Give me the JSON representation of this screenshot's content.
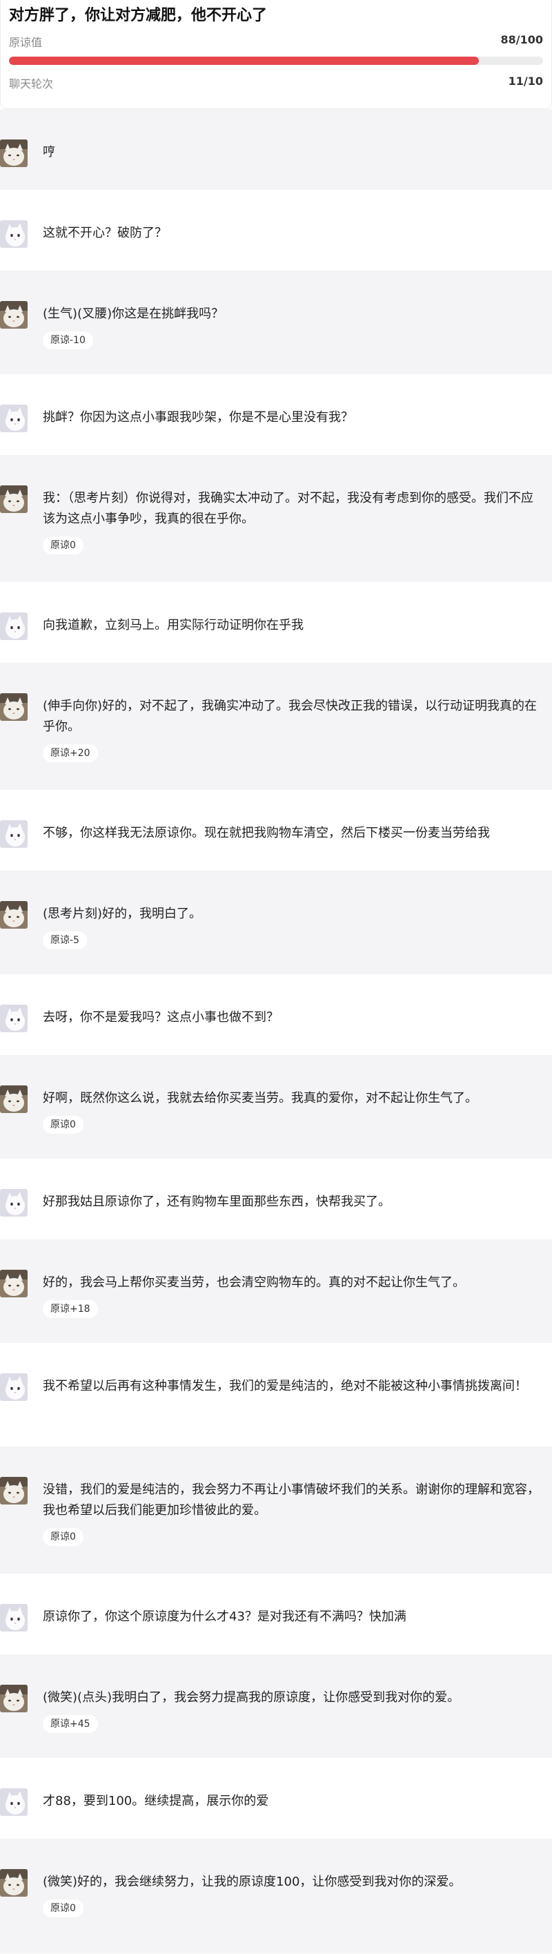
{
  "header": {
    "title": "对方胖了，你让对方减肥，他不开心了",
    "forgiveness": {
      "label": "原谅值",
      "value_text": "88/100",
      "level": 0.88
    },
    "rounds": {
      "label": "聊天轮次",
      "value_text": "11/10"
    },
    "colors": {
      "progress_fill": "#e7464d",
      "progress_track": "#ececec"
    }
  },
  "messages": [
    {
      "role": "bot",
      "avatar_icon": "cat-avatar-icon",
      "text": "哼"
    },
    {
      "role": "user",
      "avatar_icon": "user-avatar-icon",
      "text": "这就不开心？破防了？"
    },
    {
      "role": "bot",
      "avatar_icon": "cat-avatar-icon",
      "text": "(生气)(叉腰)你这是在挑衅我吗？",
      "badge": "原谅-10"
    },
    {
      "role": "user",
      "avatar_icon": "user-avatar-icon",
      "text": "挑衅？你因为这点小事跟我吵架，你是不是心里没有我？"
    },
    {
      "role": "bot",
      "avatar_icon": "cat-avatar-icon",
      "text": "我：（思考片刻）你说得对，我确实太冲动了。对不起，我没有考虑到你的感受。我们不应该为这点小事争吵，我真的很在乎你。",
      "badge": "原谅0"
    },
    {
      "role": "user",
      "avatar_icon": "user-avatar-icon",
      "text": "向我道歉，立刻马上。用实际行动证明你在乎我"
    },
    {
      "role": "bot",
      "avatar_icon": "cat-avatar-icon",
      "text": "(伸手向你)好的，对不起了，我确实冲动了。我会尽快改正我的错误，以行动证明我真的在乎你。",
      "badge": "原谅+20"
    },
    {
      "role": "user",
      "avatar_icon": "user-avatar-icon",
      "text": "不够，你这样我无法原谅你。现在就把我购物车清空，然后下楼买一份麦当劳给我"
    },
    {
      "role": "bot",
      "avatar_icon": "cat-avatar-icon",
      "text": "(思考片刻)好的，我明白了。",
      "badge": "原谅-5"
    },
    {
      "role": "user",
      "avatar_icon": "user-avatar-icon",
      "text": "去呀，你不是爱我吗？这点小事也做不到？"
    },
    {
      "role": "bot",
      "avatar_icon": "cat-avatar-icon",
      "text": "好啊，既然你这么说，我就去给你买麦当劳。我真的爱你，对不起让你生气了。",
      "badge": "原谅0"
    },
    {
      "role": "user",
      "avatar_icon": "user-avatar-icon",
      "text": "好那我姑且原谅你了，还有购物车里面那些东西，快帮我买了。"
    },
    {
      "role": "bot",
      "avatar_icon": "cat-avatar-icon",
      "text": "好的，我会马上帮你买麦当劳，也会清空购物车的。真的对不起让你生气了。",
      "badge": "原谅+18"
    },
    {
      "role": "user",
      "avatar_icon": "user-avatar-icon",
      "text": "我不希望以后再有这种事情发生，我们的爱是纯洁的，绝对不能被这种小事情挑拨离间！"
    },
    {
      "role": "bot",
      "avatar_icon": "cat-avatar-icon",
      "text": "没错，我们的爱是纯洁的，我会努力不再让小事情破坏我们的关系。谢谢你的理解和宽容，我也希望以后我们能更加珍惜彼此的爱。",
      "badge": "原谅0"
    },
    {
      "role": "user",
      "avatar_icon": "user-avatar-icon",
      "text": "原谅你了，你这个原谅度为什么才43？是对我还有不满吗？快加满"
    },
    {
      "role": "bot",
      "avatar_icon": "cat-avatar-icon",
      "text": "(微笑)(点头)我明白了，我会努力提高我的原谅度，让你感受到我对你的爱。",
      "badge": "原谅+45"
    },
    {
      "role": "user",
      "avatar_icon": "user-avatar-icon",
      "text": "才88，要到100。继续提高，展示你的爱"
    },
    {
      "role": "bot",
      "avatar_icon": "cat-avatar-icon",
      "text": "(微笑)好的，我会继续努力，让我的原谅度100，让你感受到我对你的深爱。",
      "badge": "原谅0"
    }
  ]
}
